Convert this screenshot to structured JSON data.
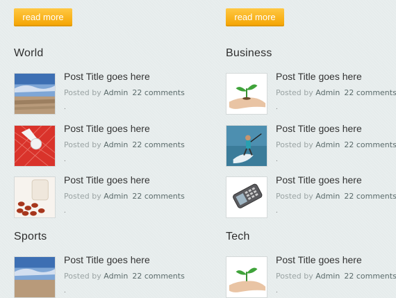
{
  "buttons": {
    "read_more": "read more"
  },
  "columns": [
    {
      "sections": [
        {
          "title": "World",
          "posts": [
            {
              "title": "Post Title goes here",
              "posted_by": "Posted by",
              "author": "Admin",
              "comments": "22 comments",
              "excerpt": ".",
              "thumb": "beach-photo"
            },
            {
              "title": "Post Title goes here",
              "posted_by": "Posted by",
              "author": "Admin",
              "comments": "22 comments",
              "excerpt": ".",
              "thumb": "badminton-photo"
            },
            {
              "title": "Post Title goes here",
              "posted_by": "Posted by",
              "author": "Admin",
              "comments": "22 comments",
              "excerpt": ".",
              "thumb": "pills-photo"
            }
          ]
        },
        {
          "title": "Sports",
          "posts": [
            {
              "title": "Post Title goes here",
              "posted_by": "Posted by",
              "author": "Admin",
              "comments": "22 comments",
              "excerpt": ".",
              "thumb": "beach-photo"
            }
          ]
        }
      ]
    },
    {
      "sections": [
        {
          "title": "Business",
          "posts": [
            {
              "title": "Post Title goes here",
              "posted_by": "Posted by",
              "author": "Admin",
              "comments": "22 comments",
              "excerpt": ".",
              "thumb": "plant-hand-photo"
            },
            {
              "title": "Post Title goes here",
              "posted_by": "Posted by",
              "author": "Admin",
              "comments": "22 comments",
              "excerpt": ".",
              "thumb": "kitesurf-photo"
            },
            {
              "title": "Post Title goes here",
              "posted_by": "Posted by",
              "author": "Admin",
              "comments": "22 comments",
              "excerpt": ".",
              "thumb": "phone-photo"
            }
          ]
        },
        {
          "title": "Tech",
          "posts": [
            {
              "title": "Post Title goes here",
              "posted_by": "Posted by",
              "author": "Admin",
              "comments": "22 comments",
              "excerpt": ".",
              "thumb": "plant-hand-photo"
            }
          ]
        }
      ]
    }
  ]
}
